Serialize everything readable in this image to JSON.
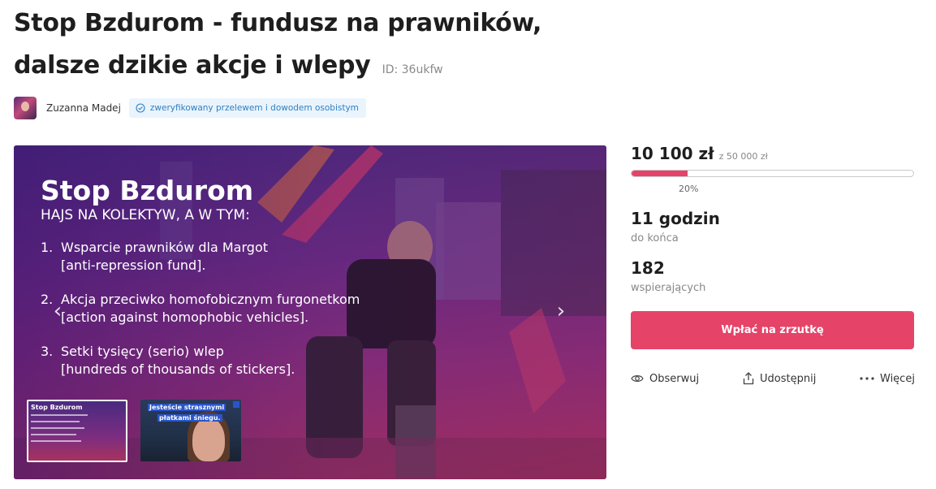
{
  "campaign": {
    "title": "Stop Bzdurom - fundusz na prawników, dalsze dzikie akcje i wlepy",
    "id_label": "ID: 36ukfw"
  },
  "author": {
    "name": "Zuzanna Madej",
    "verified_label": "zweryfikowany przelewem i dowodem osobistym"
  },
  "hero": {
    "heading": "Stop Bzdurom",
    "subheading": "HAJS NA KOLEKTYW, A W TYM:",
    "items": [
      {
        "num": "1.",
        "pl": "Wsparcie prawników dla Margot",
        "en": "[anti-repression fund]."
      },
      {
        "num": "2.",
        "pl": "Akcja przeciwko homofobicznym furgonetkom",
        "en": "[action against homophobic vehicles]."
      },
      {
        "num": "3.",
        "pl": "Setki tysięcy (serio) wlep",
        "en": "[hundreds of thousands of stickers]."
      }
    ],
    "prev_icon": "chevron-left-icon",
    "next_icon": "chevron-right-icon",
    "thumbnails": [
      {
        "caption": "Stop Bzdurom"
      },
      {
        "caption_line1": "Jesteście strasznymi",
        "caption_line2": "płatkami  śniegu."
      }
    ]
  },
  "stats": {
    "raised": "10 100 zł",
    "goal": "z 50 000 zł",
    "progress_fraction": 0.2,
    "percent_label": "20%",
    "time_value": "11 godzin",
    "time_label": "do końca",
    "supporters_value": "182",
    "supporters_label": "wspierających"
  },
  "actions": {
    "donate_label": "Wpłać na zrzutkę",
    "follow_label": "Obserwuj",
    "share_label": "Udostępnij",
    "more_label": "Więcej",
    "follow_icon": "eye-icon",
    "share_icon": "share-icon",
    "more_icon": "ellipsis-icon"
  },
  "colors": {
    "accent": "#e64369",
    "verified_bg": "#eaf4fd",
    "verified_text": "#2f7fc0"
  }
}
